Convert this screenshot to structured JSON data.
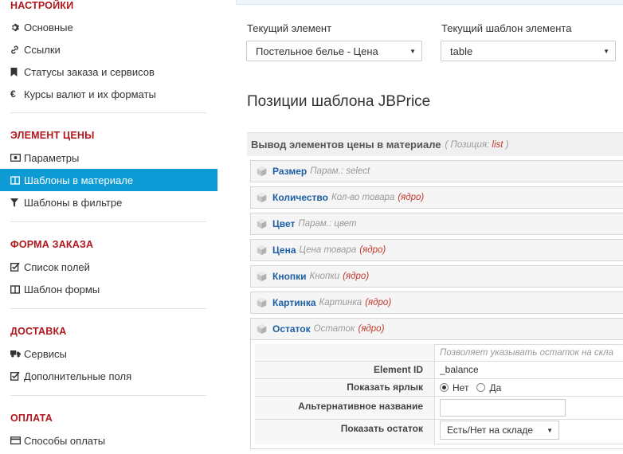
{
  "sidebar": {
    "sections": [
      {
        "title": "НАСТРОЙКИ",
        "items": [
          {
            "label": "Основные",
            "icon": "gear-icon"
          },
          {
            "label": "Ссылки",
            "icon": "link-icon"
          },
          {
            "label": "Статусы заказа и сервисов",
            "icon": "bookmark-icon"
          },
          {
            "label": "Курсы валют и их форматы",
            "icon": "euro-icon"
          }
        ]
      },
      {
        "title": "ЭЛЕМЕНТ ЦЕНЫ",
        "items": [
          {
            "label": "Параметры",
            "icon": "money-icon"
          },
          {
            "label": "Шаблоны в материале",
            "icon": "columns-icon",
            "active": true
          },
          {
            "label": "Шаблоны в фильтре",
            "icon": "filter-icon"
          }
        ]
      },
      {
        "title": "ФОРМА ЗАКАЗА",
        "items": [
          {
            "label": "Список полей",
            "icon": "checkbox-icon"
          },
          {
            "label": "Шаблон формы",
            "icon": "columns-icon"
          }
        ]
      },
      {
        "title": "ДОСТАВКА",
        "items": [
          {
            "label": "Сервисы",
            "icon": "truck-icon"
          },
          {
            "label": "Дополнительные поля",
            "icon": "checkbox-icon"
          }
        ]
      },
      {
        "title": "ОПЛАТА",
        "items": [
          {
            "label": "Способы оплаты",
            "icon": "credit-card-icon"
          }
        ]
      }
    ]
  },
  "main": {
    "current_element_label": "Текущий элемент",
    "current_element_value": "Постельное белье - Цена",
    "current_template_label": "Текущий шаблон элемента",
    "current_template_value": "table",
    "heading": "Позиции шаблона JBPrice",
    "panel": {
      "title": "Вывод элементов цены в материале",
      "position_prefix": "( Позиция:",
      "position_value": "list",
      "position_suffix": ")"
    },
    "rows": [
      {
        "name": "Размер",
        "desc": "Парам.: select",
        "core": ""
      },
      {
        "name": "Количество",
        "desc": "Кол-во товара",
        "core": "(ядро)"
      },
      {
        "name": "Цвет",
        "desc": "Парам.: цвет",
        "core": ""
      },
      {
        "name": "Цена",
        "desc": "Цена товара",
        "core": "(ядро)"
      },
      {
        "name": "Кнопки",
        "desc": "Кнопки",
        "core": "(ядро)"
      },
      {
        "name": "Картинка",
        "desc": "Картинка",
        "core": "(ядро)"
      },
      {
        "name": "Остаток",
        "desc": "Остаток",
        "core": "(ядро)"
      }
    ],
    "detail": {
      "hint": "Позволяет указывать остаток на скла",
      "element_id_label": "Element ID",
      "element_id_value": "_balance",
      "show_label_label": "Показать ярлык",
      "radio_no": "Нет",
      "radio_yes": "Да",
      "alt_name_label": "Альтернативное название",
      "alt_name_value": "",
      "show_balance_label": "Показать остаток",
      "show_balance_value": "Есть/Нет на складе"
    }
  },
  "colors": {
    "accent": "#0d9bd6",
    "section_title": "#b0161c",
    "link": "#1d5fa3",
    "core": "#c0392b"
  }
}
